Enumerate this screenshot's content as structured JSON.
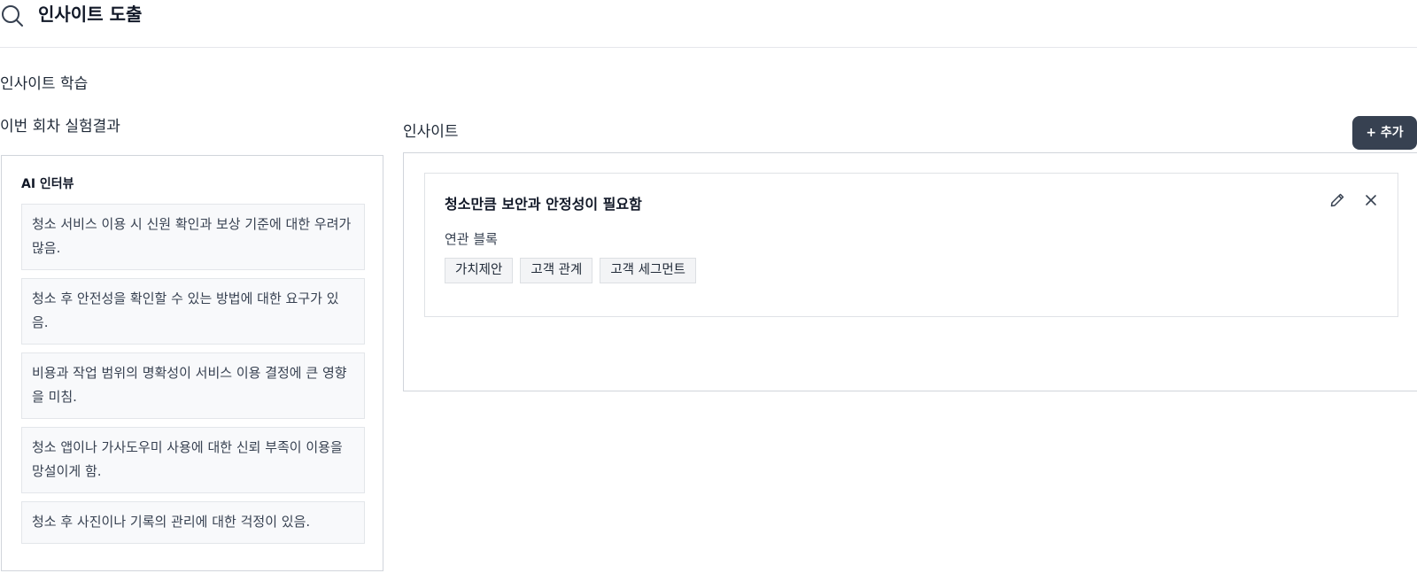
{
  "header": {
    "search_icon": "search-icon",
    "title": "인사이트 도출"
  },
  "section": {
    "title": "인사이트 학습"
  },
  "left": {
    "title": "이번 회차 실험결과",
    "panel_label": "AI 인터뷰",
    "items": [
      "청소 서비스 이용 시 신원 확인과 보상 기준에 대한 우려가 많음.",
      "청소 후 안전성을 확인할 수 있는 방법에 대한 요구가 있음.",
      "비용과 작업 범위의 명확성이 서비스 이용 결정에 큰 영향을 미침.",
      "청소 앱이나 가사도우미 사용에 대한 신뢰 부족이 이용을 망설이게 함.",
      "청소 후 사진이나 기록의 관리에 대한 걱정이 있음."
    ]
  },
  "right": {
    "title": "인사이트",
    "add_button": "+ 추가",
    "card": {
      "title": "청소만큼 보안과 안정성이 필요함",
      "related_label": "연관 블록",
      "tags": [
        "가치제안",
        "고객 관계",
        "고객 세그먼트"
      ],
      "edit_icon": "pencil-icon",
      "close_icon": "close-icon"
    }
  },
  "colors": {
    "button_bg": "#374151",
    "border": "#d1d5db",
    "item_bg": "#f8f9fb"
  }
}
